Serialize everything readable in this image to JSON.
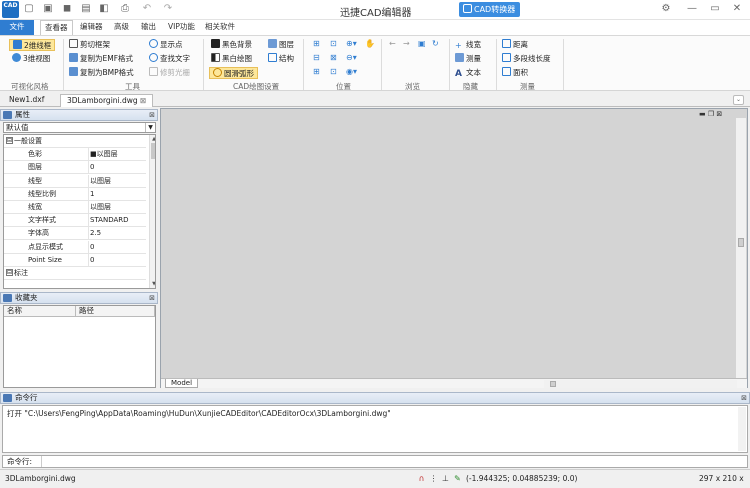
{
  "app": {
    "title": "迅捷CAD编辑器",
    "converter_button": "CAD转换器",
    "icon_text": "CAD"
  },
  "menu_tabs": [
    "文件",
    "查看器",
    "编辑器",
    "高级",
    "输出",
    "VIP功能",
    "相关软件"
  ],
  "ribbon": {
    "groups": [
      {
        "label": "可视化风格",
        "buttons": [
          "2维线框",
          "3维视图"
        ]
      },
      {
        "label": "工具",
        "buttons": [
          "剪切框架",
          "复制为EMF格式",
          "复制为BMP格式",
          "显示点",
          "查找文字",
          "修剪光栅"
        ]
      },
      {
        "label": "CAD绘图设置",
        "buttons": [
          "黑色背景",
          "黑白绘图",
          "圆滑弧形",
          "图层",
          "结构"
        ]
      },
      {
        "label": "位置",
        "buttons": []
      },
      {
        "label": "浏览",
        "buttons": []
      },
      {
        "label": "隐藏",
        "buttons": [
          "线宽",
          "测量",
          "文本"
        ]
      },
      {
        "label": "测量",
        "buttons": [
          "距离",
          "多段线长度",
          "面积"
        ]
      }
    ]
  },
  "document_tabs": [
    "New1.dxf",
    "3DLamborgini.dwg"
  ],
  "properties": {
    "title": "属性",
    "dropdown": "默认值",
    "rows": [
      {
        "type": "category",
        "key": "一般设置",
        "toggle": "⊟"
      },
      {
        "type": "prop",
        "key": "色彩",
        "value": "■以图层"
      },
      {
        "type": "prop",
        "key": "图层",
        "value": "0"
      },
      {
        "type": "prop",
        "key": "线型",
        "value": "以图层"
      },
      {
        "type": "prop",
        "key": "线型比例",
        "value": "1"
      },
      {
        "type": "prop",
        "key": "线宽",
        "value": "以图层"
      },
      {
        "type": "prop",
        "key": "文字样式",
        "value": "STANDARD"
      },
      {
        "type": "prop",
        "key": "字体高",
        "value": "2.5"
      },
      {
        "type": "prop",
        "key": "点显示模式",
        "value": "0"
      },
      {
        "type": "prop",
        "key": "Point Size",
        "value": "0"
      },
      {
        "type": "category",
        "key": "标注",
        "toggle": "⊟"
      }
    ]
  },
  "favorites": {
    "title": "收藏夹",
    "columns": [
      "名称",
      "路径"
    ]
  },
  "canvas": {
    "model_tab": "Model"
  },
  "command": {
    "title": "命令行",
    "output": "打开 \"C:\\Users\\FengPing\\AppData\\Roaming\\HuDun\\XunjieCADEditor\\CADEditorOcx\\3DLamborgini.dwg\"",
    "input_label": "命令行:",
    "input_value": ""
  },
  "status": {
    "file": "3DLamborgini.dwg",
    "coords": "(-1.944325; 0.04885239; 0.0)",
    "paper_size": "297 x 210 x 0"
  },
  "colors": {
    "accent": "#2f7dd1",
    "converter": "#3b8de0",
    "canvas": "#d4d4d4"
  }
}
